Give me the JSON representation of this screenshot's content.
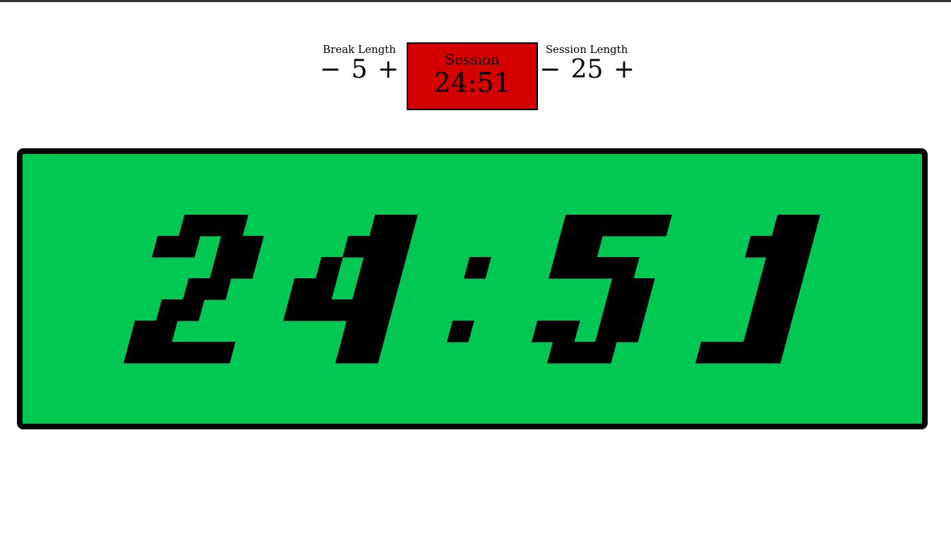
{
  "break": {
    "label": "Break Length",
    "decrement": "−",
    "value": "5",
    "increment": "+"
  },
  "session": {
    "label": "Session Length",
    "decrement": "−",
    "value": "25",
    "increment": "+"
  },
  "status": {
    "label": "Session",
    "time": "24:51"
  },
  "display": {
    "time": "24:51"
  },
  "colors": {
    "status_bg": "#d40000",
    "display_bg": "#00c853",
    "digit": "#000000"
  }
}
